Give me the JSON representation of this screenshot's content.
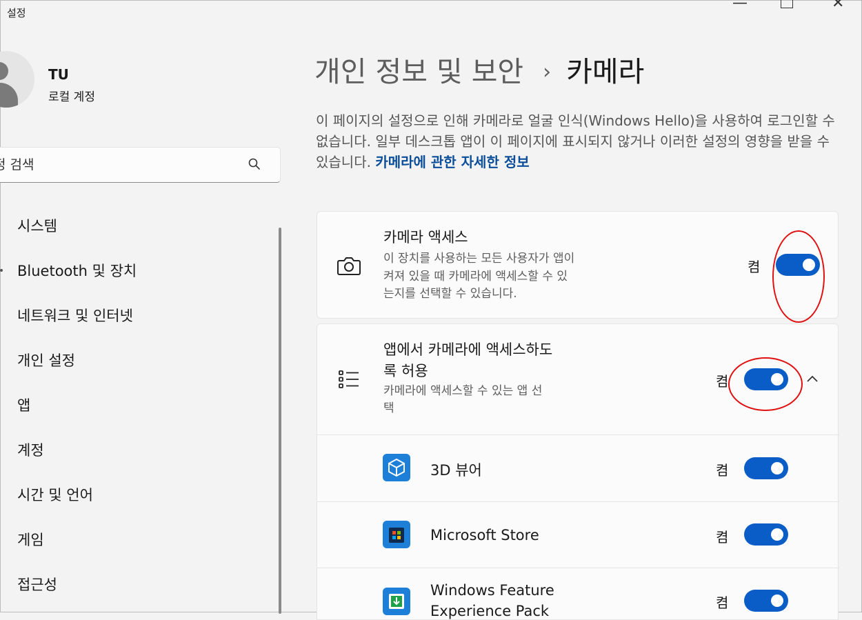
{
  "window": {
    "title": "설정"
  },
  "user": {
    "name": "TU",
    "account_type": "로컬 계정"
  },
  "search": {
    "placeholder": "정 검색"
  },
  "nav": {
    "items": [
      {
        "label": "시스템"
      },
      {
        "label": "Bluetooth 및 장치"
      },
      {
        "label": "네트워크 및 인터넷"
      },
      {
        "label": "개인 설정"
      },
      {
        "label": "앱"
      },
      {
        "label": "계정"
      },
      {
        "label": "시간 및 언어"
      },
      {
        "label": "게임"
      },
      {
        "label": "접근성"
      }
    ]
  },
  "header": {
    "parent": "개인 정보 및 보안",
    "separator": "›",
    "current": "카메라"
  },
  "description": {
    "text": "이 페이지의 설정으로 인해 카메라로 얼굴 인식(Windows Hello)을 사용하여 로그인할 수 없습니다. 일부 데스크톱 앱이 이 페이지에 표시되지 않거나 이러한 설정의 영향을 받을 수 있습니다.",
    "link": "카메라에 관한 자세한 정보"
  },
  "camera_access": {
    "title": "카메라 액세스",
    "subtitle_lines": [
      "이 장치를 사용하는 모든 사용자가 앱이",
      "켜져 있을 때 카메라에 액세스할 수 있",
      "는지를 선택할 수 있습니다."
    ],
    "state_label": "켬",
    "enabled": true
  },
  "app_access": {
    "title_lines": [
      "앱에서 카메라에 액세스하도",
      "록 허용"
    ],
    "subtitle_lines": [
      "카메라에 액세스할 수 있는 앱 선",
      "택"
    ],
    "state_label": "켬",
    "enabled": true,
    "expanded": true
  },
  "apps": [
    {
      "name": "3D 뷰어",
      "state_label": "켬",
      "enabled": true,
      "icon": "cube-icon",
      "color": "#1d7fd8"
    },
    {
      "name": "Microsoft Store",
      "state_label": "켬",
      "enabled": true,
      "icon": "store-icon",
      "color": "#1d7fd8"
    },
    {
      "name_lines": [
        "Windows Feature",
        "Experience Pack"
      ],
      "state_label": "켬",
      "enabled": true,
      "icon": "download-icon",
      "color": "#1d7fd8"
    }
  ],
  "colors": {
    "accent": "#0a5cc7",
    "link": "#0a4e9a",
    "annotation": "#e01010"
  }
}
